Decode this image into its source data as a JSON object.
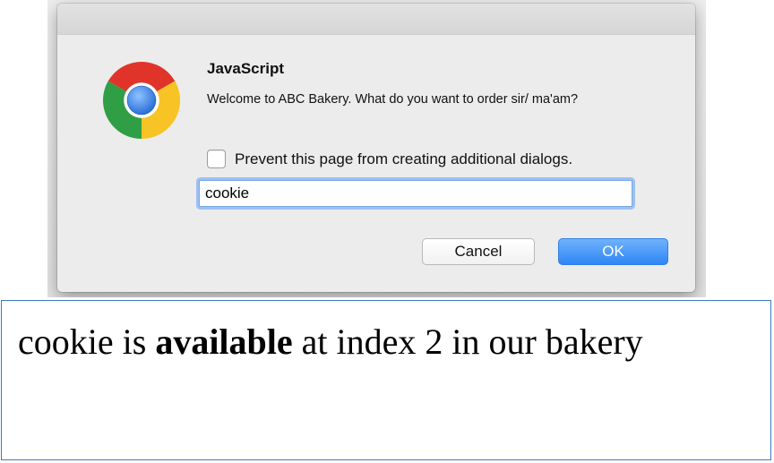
{
  "dialog": {
    "title": "JavaScript",
    "message": "Welcome to ABC Bakery. What do you want to order sir/ ma'am?",
    "prevent_label": "Prevent this page from creating additional dialogs.",
    "prevent_checked": false,
    "input_value": "cookie",
    "cancel_label": "Cancel",
    "ok_label": "OK",
    "icon": "chrome-logo-icon"
  },
  "output": {
    "before": "cookie is ",
    "bold": "available",
    "after": " at index 2 in our bakery"
  },
  "colors": {
    "ok_button": "#3b8ef7",
    "output_border": "#3b7bbf",
    "input_focus": "#9cc0f2"
  }
}
